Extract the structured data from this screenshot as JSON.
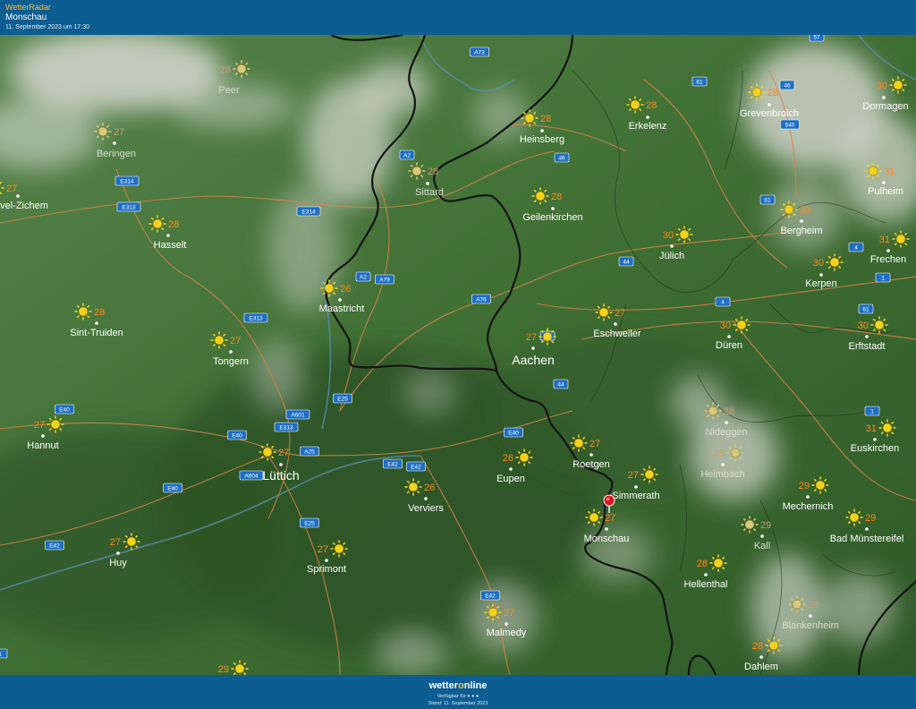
{
  "header": {
    "brand": "WetterRadar",
    "location": "Monschau",
    "timestamp": "11. September 2023 um 17:30"
  },
  "footer": {
    "logo_main": "wetter",
    "logo_o": "o",
    "logo_rest": "nline",
    "availability": "Verfügbar für",
    "stand": "Stand: 11. September 2023"
  },
  "colors": {
    "header_bg": "#0b5d92",
    "brand": "#f2c14e",
    "temperature": "#ff8a1a",
    "sun": "#f5d21a",
    "marker": "#e0141e",
    "road_label": "#1f6fc4"
  },
  "selected_location": "Monschau",
  "cities": [
    {
      "name": "Peer",
      "temp": "28",
      "dim": true
    },
    {
      "name": "Beringen",
      "temp": "27",
      "dim": true
    },
    {
      "name": "vel-Zichem",
      "temp": "27"
    },
    {
      "name": "Hasselt",
      "temp": "28"
    },
    {
      "name": "Sint-Truiden",
      "temp": "28"
    },
    {
      "name": "Tongern",
      "temp": "27"
    },
    {
      "name": "Maastricht",
      "temp": "26"
    },
    {
      "name": "Sittard",
      "temp": "28",
      "dim": true
    },
    {
      "name": "Heinsberg",
      "temp": "28"
    },
    {
      "name": "Erkelenz",
      "temp": "28"
    },
    {
      "name": "Grevenbroich",
      "temp": "28"
    },
    {
      "name": "Dormagen",
      "temp": "30"
    },
    {
      "name": "Geilenkirchen",
      "temp": "28"
    },
    {
      "name": "Pulheim",
      "temp": "31"
    },
    {
      "name": "Jülich",
      "temp": "30"
    },
    {
      "name": "Bergheim",
      "temp": "30"
    },
    {
      "name": "Frechen",
      "temp": "31"
    },
    {
      "name": "Kerpen",
      "temp": "30"
    },
    {
      "name": "Eschweiler",
      "temp": "27"
    },
    {
      "name": "Aachen",
      "temp": "27",
      "big": true
    },
    {
      "name": "Düren",
      "temp": "30"
    },
    {
      "name": "Erftstadt",
      "temp": "30"
    },
    {
      "name": "Hannut",
      "temp": "27"
    },
    {
      "name": "Lüttich",
      "temp": "27",
      "big": true
    },
    {
      "name": "Nideggen",
      "temp": "28",
      "dim": true
    },
    {
      "name": "Euskirchen",
      "temp": "31"
    },
    {
      "name": "Roetgen",
      "temp": "27"
    },
    {
      "name": "Eupen",
      "temp": "26"
    },
    {
      "name": "Heimbach",
      "temp": "28",
      "dim": true
    },
    {
      "name": "Verviers",
      "temp": "26"
    },
    {
      "name": "Simmerath",
      "temp": "27"
    },
    {
      "name": "Mechernich",
      "temp": "29"
    },
    {
      "name": "Monschau",
      "temp": "27"
    },
    {
      "name": "Kall",
      "temp": "29",
      "dim": true
    },
    {
      "name": "Bad Münstereifel",
      "temp": "29"
    },
    {
      "name": "Huy",
      "temp": "27"
    },
    {
      "name": "Sprimont",
      "temp": "27"
    },
    {
      "name": "Hellenthal",
      "temp": "28"
    },
    {
      "name": "Blankenheim",
      "temp": "28",
      "dim": true
    },
    {
      "name": "Malmedy",
      "temp": "27"
    },
    {
      "name": "Dahlem",
      "temp": "28"
    },
    {
      "name": "",
      "temp": "29"
    }
  ],
  "roads": [
    "A73",
    "57",
    "61",
    "46",
    "540",
    "E314",
    "A2",
    "46",
    "E313",
    "E314",
    "61",
    "4",
    "A2",
    "A79",
    "44",
    "A76",
    "E313",
    "4",
    "1",
    "61",
    "4",
    "E40",
    "A601",
    "E313",
    "E25",
    "44",
    "1",
    "E40",
    "A25",
    "A604",
    "E40",
    "E42",
    "E40",
    "E42",
    "E25",
    "E42",
    "E42",
    "1"
  ]
}
